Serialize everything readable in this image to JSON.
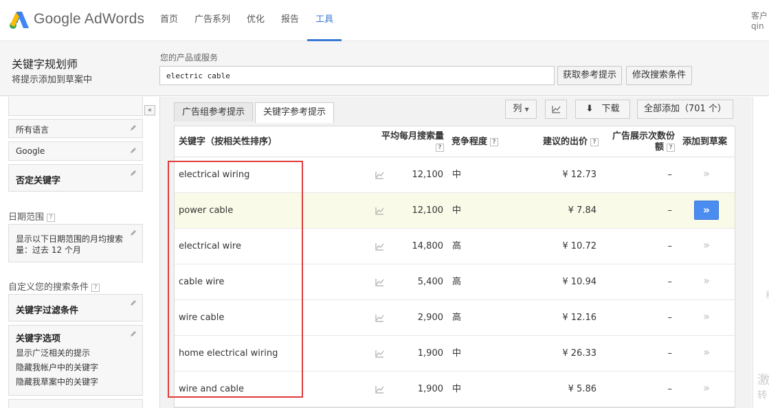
{
  "brand": "Google AdWords",
  "nav": [
    {
      "label": "首页",
      "active": false
    },
    {
      "label": "广告系列",
      "active": false
    },
    {
      "label": "优化",
      "active": false
    },
    {
      "label": "报告",
      "active": false
    },
    {
      "label": "工具",
      "active": true
    }
  ],
  "account": {
    "line1": "客户",
    "line2": "qin"
  },
  "tool": {
    "title": "关键字规划师",
    "subtitle": "将提示添加到草案中"
  },
  "product": {
    "label": "您的产品或服务",
    "value": "electric cable"
  },
  "buttons": {
    "get_ideas": "获取参考提示",
    "modify": "修改搜索条件"
  },
  "left": {
    "language": "所有语言",
    "network": "Google",
    "negative": "否定关键字",
    "date_section": "日期范围",
    "date_text": "显示以下日期范围的月均搜索量：过去 12 个月",
    "custom_section": "自定义您的搜索条件",
    "filter": "关键字过滤条件",
    "options_title": "关键字选项",
    "options": [
      "显示广泛相关的提示",
      "隐藏我帐户中的关键字",
      "隐藏我草案中的关键字"
    ],
    "collapse_icon": "«"
  },
  "tabs": [
    {
      "label": "广告组参考提示",
      "active": false
    },
    {
      "label": "关键字参考提示",
      "active": true
    }
  ],
  "toolbar": {
    "columns": "列",
    "download": "下载",
    "add_all": "全部添加（701 个）"
  },
  "table": {
    "headers": {
      "keyword": "关键字（按相关性排序）",
      "searches": "平均每月搜索量",
      "competition": "竞争程度",
      "bid": "建议的出价",
      "impression_share": "广告展示次数份额",
      "add": "添加到草案"
    },
    "help": "?",
    "rows": [
      {
        "keyword": "electrical wiring",
        "searches": "12,100",
        "competition": "中",
        "bid": "¥ 12.73",
        "share": "–",
        "added": false
      },
      {
        "keyword": "power cable",
        "searches": "12,100",
        "competition": "中",
        "bid": "¥ 7.84",
        "share": "–",
        "added": true
      },
      {
        "keyword": "electrical wire",
        "searches": "14,800",
        "competition": "高",
        "bid": "¥ 10.72",
        "share": "–",
        "added": false
      },
      {
        "keyword": "cable wire",
        "searches": "5,400",
        "competition": "高",
        "bid": "¥ 10.94",
        "share": "–",
        "added": false
      },
      {
        "keyword": "wire cable",
        "searches": "2,900",
        "competition": "高",
        "bid": "¥ 12.16",
        "share": "–",
        "added": false
      },
      {
        "keyword": "home electrical wiring",
        "searches": "1,900",
        "competition": "中",
        "bid": "¥ 26.33",
        "share": "–",
        "added": false
      },
      {
        "keyword": "wire and cable",
        "searches": "1,900",
        "competition": "中",
        "bid": "¥ 5.86",
        "share": "–",
        "added": false
      }
    ],
    "add_icon": "»"
  },
  "right_strip": {
    "char1": "相",
    "char2": "激",
    "char3": "转"
  },
  "colors": {
    "accent": "#3a78d6",
    "highlight_row": "#fafae8",
    "red_box": "#e03a3a",
    "add_button": "#4a8cf0"
  }
}
